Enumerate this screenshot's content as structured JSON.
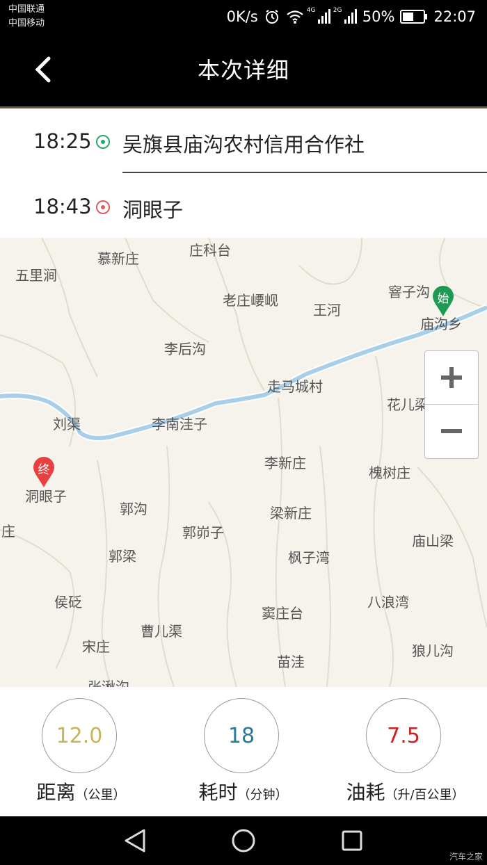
{
  "status_bar": {
    "carrier_1": "中国联通",
    "carrier_2": "中国移动",
    "net_speed": "0K/s",
    "net_4g": "4G",
    "net_2g": "2G",
    "battery": "50%",
    "time": "22:07",
    "icons": [
      "alarm-icon",
      "wifi-icon",
      "signal-icon",
      "battery-icon"
    ]
  },
  "app_bar": {
    "title": "本次详细",
    "back_icon": "chevron-left-icon"
  },
  "route": {
    "start_time": "18:25",
    "start_place": "吴旗县庙沟农村信用合作社",
    "end_time": "18:43",
    "end_place": "洞眼子"
  },
  "map": {
    "labels": [
      "慕新庄",
      "庄科台",
      "五里涧",
      "老庄崾岘",
      "王河",
      "窨子沟",
      "庙沟乡",
      "李后沟",
      "走马城村",
      "花儿梁",
      "刘渠",
      "李南洼子",
      "李新庄",
      "槐树庄",
      "洞眼子",
      "郭沟",
      "梁新庄",
      "郭峁子",
      "庙山梁",
      "郭梁",
      "枫子湾",
      "侯砭",
      "八浪湾",
      "窦庄台",
      "曹儿渠",
      "宋庄",
      "狼儿沟",
      "苗洼",
      "张湫沟",
      "庄"
    ],
    "start_marker": "始",
    "end_marker": "终",
    "zoom_in_icon": "plus-icon",
    "zoom_out_icon": "minus-icon",
    "start_color": "#1f9a55",
    "end_color": "#e84040",
    "river_color": "#a9cfe8"
  },
  "stats": {
    "distance": {
      "value": "12.0",
      "name": "距离",
      "unit": "（公里）",
      "color": "#c8b45a"
    },
    "duration": {
      "value": "18",
      "name": "耗时",
      "unit": "（分钟）",
      "color": "#2a7a9a"
    },
    "fuel": {
      "value": "7.5",
      "name": "油耗",
      "unit": "（升/百公里）",
      "color": "#cc2222"
    }
  },
  "nav_bar": {
    "icons": [
      "back-triangle-icon",
      "home-circle-icon",
      "recents-square-icon"
    ],
    "watermark": "汽车之家"
  }
}
